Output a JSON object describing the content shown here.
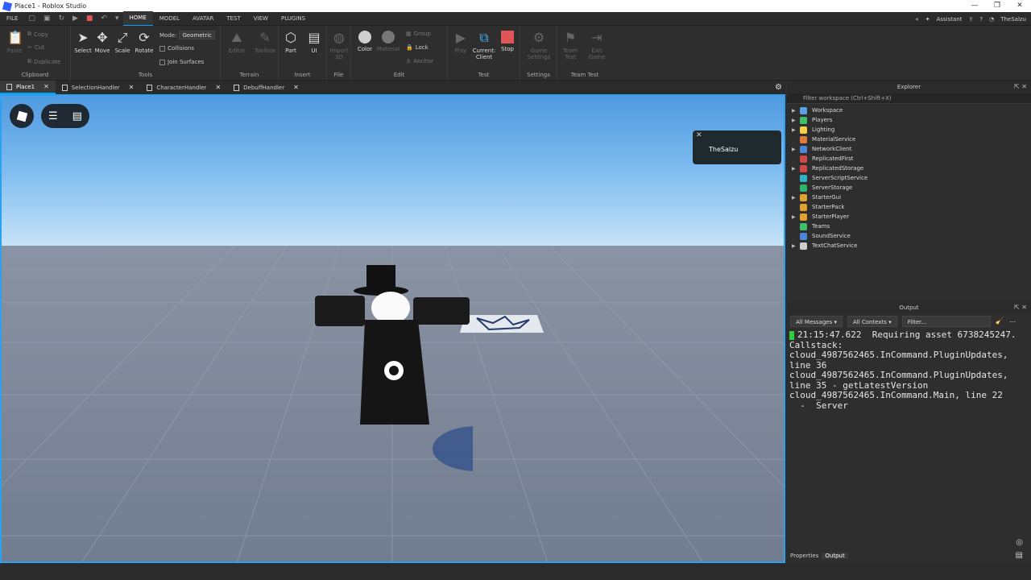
{
  "titlebar": {
    "title": "Place1 - Roblox Studio",
    "controls": [
      "—",
      "❐",
      "✕"
    ]
  },
  "menubar": {
    "file": "FILE",
    "tabs": [
      "HOME",
      "MODEL",
      "AVATAR",
      "TEST",
      "VIEW",
      "PLUGINS"
    ],
    "active_tab": "HOME",
    "assistant": "Assistant",
    "user": "TheSalzu"
  },
  "ribbon": {
    "clipboard": {
      "label": "Clipboard",
      "paste": "Paste",
      "copy": "Copy",
      "cut": "Cut",
      "duplicate": "Duplicate"
    },
    "tools": {
      "label": "Tools",
      "select": "Select",
      "move": "Move",
      "scale": "Scale",
      "rotate": "Rotate",
      "mode_label": "Mode:",
      "mode_value": "Geometric",
      "collisions": "Collisions",
      "join_surfaces": "Join Surfaces"
    },
    "terrain": {
      "label": "Terrain",
      "editor": "Editor",
      "toolbox": "Toolbox"
    },
    "insert": {
      "label": "Insert",
      "part": "Part",
      "ui": "UI"
    },
    "file": {
      "label": "File",
      "import3d": "Import 3D"
    },
    "edit": {
      "label": "Edit",
      "color": "Color",
      "material": "Material",
      "group": "Group",
      "lock": "Lock",
      "anchor": "Anchor"
    },
    "test": {
      "label": "Test",
      "play": "Play",
      "current_client": "Current: Client",
      "stop": "Stop"
    },
    "settings": {
      "label": "Settings",
      "game_settings": "Game Settings"
    },
    "team_test": {
      "label": "Team Test",
      "team_test": "Team Test",
      "exit_game": "Exit Game"
    }
  },
  "doc_tabs": [
    {
      "label": "Place1",
      "active": true
    },
    {
      "label": "SelectionHandler",
      "active": false
    },
    {
      "label": "CharacterHandler",
      "active": false
    },
    {
      "label": "DebuffHandler",
      "active": false
    }
  ],
  "viewport": {
    "namecard_user": "TheSalzu"
  },
  "explorer": {
    "title": "Explorer",
    "filter_placeholder": "Filter workspace (Ctrl+Shift+X)",
    "items": [
      {
        "label": "Workspace",
        "expand": true,
        "color": "#5aa0e6"
      },
      {
        "label": "Players",
        "expand": true,
        "color": "#3fbf6a"
      },
      {
        "label": "Lighting",
        "expand": true,
        "color": "#f2d14a"
      },
      {
        "label": "MaterialService",
        "expand": false,
        "color": "#e07b3a"
      },
      {
        "label": "NetworkClient",
        "expand": true,
        "color": "#4c86d6"
      },
      {
        "label": "ReplicatedFirst",
        "expand": false,
        "color": "#d04848"
      },
      {
        "label": "ReplicatedStorage",
        "expand": true,
        "color": "#d04848"
      },
      {
        "label": "ServerScriptService",
        "expand": false,
        "color": "#2fb3c8"
      },
      {
        "label": "ServerStorage",
        "expand": false,
        "color": "#2fb36a"
      },
      {
        "label": "StarterGui",
        "expand": true,
        "color": "#e0a030"
      },
      {
        "label": "StarterPack",
        "expand": false,
        "color": "#e0a030"
      },
      {
        "label": "StarterPlayer",
        "expand": true,
        "color": "#e0a030"
      },
      {
        "label": "Teams",
        "expand": false,
        "color": "#3fbf6a"
      },
      {
        "label": "SoundService",
        "expand": false,
        "color": "#4c86d6"
      },
      {
        "label": "TextChatService",
        "expand": true,
        "color": "#cccccc"
      }
    ]
  },
  "output": {
    "title": "Output",
    "messages_filter": "All Messages",
    "contexts_filter": "All Contexts",
    "filter_placeholder": "Filter...",
    "text": "21:15:47.622  Requiring asset 6738245247.\nCallstack:\ncloud_4987562465.InCommand.PluginUpdates, line 36\ncloud_4987562465.InCommand.PluginUpdates, line 35 - getLatestVersion\ncloud_4987562465.InCommand.Main, line 22\n  -  Server"
  },
  "bottom_tabs": {
    "properties": "Properties",
    "output": "Output"
  }
}
